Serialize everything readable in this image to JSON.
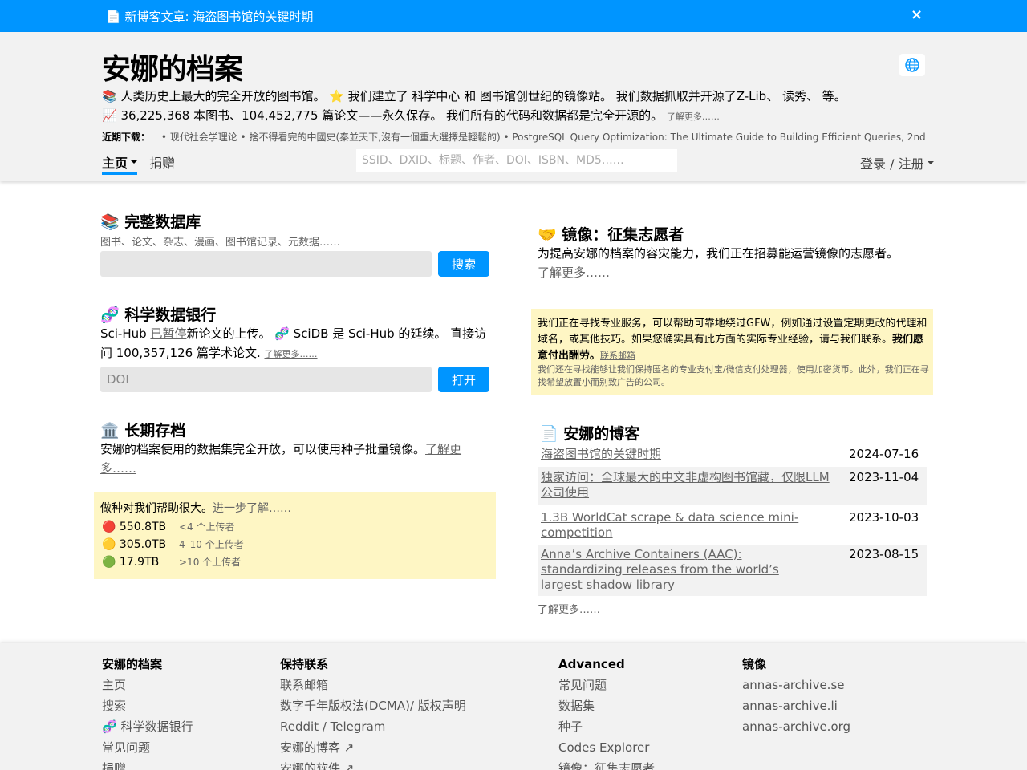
{
  "announcement": {
    "icon": "📄",
    "prefix": "新博客文章:",
    "link": "海盗图书馆的关键时期",
    "close": "×"
  },
  "header": {
    "title": "安娜的档案",
    "tagline1": "📚 人类历史上最大的完全开放的图书馆。 ⭐️ 我们建立了 科学中心 和 图书馆创世纪的镜像站。 我们数据抓取并开源了Z-Lib、 读秀、 等。",
    "tagline2": "📈 36,225,368 本图书、104,452,775 篇论文——永久保存。 我们所有的代码和数据都是完全开源的。",
    "learn_more": "了解更多……",
    "recent_label": "近期下载：",
    "recent_items": "• 现代社会学理论 • 捨不得看完的中國史(秦並天下,沒有一個重大選擇是輕鬆的) • PostgreSQL Query Optimization: The Ultimate Guide to Building Efficient Queries, 2nd",
    "nav_home": "主页",
    "nav_donate": "捐赠",
    "search_placeholder": "SSID、DXID、标题、作者、DOI、ISBN、MD5……",
    "login": "登录 / 注册"
  },
  "full_db": {
    "title": "📚 完整数据库",
    "subtitle": "图书、论文、杂志、漫画、图书馆记录、元数据……",
    "button": "搜索"
  },
  "scidb": {
    "title": "🧬 科学数据银行",
    "text_a": "Sci-Hub",
    "text_paused": "已暂停",
    "text_b": "新论文的上传。 🧬 SciDB 是 Sci-Hub 的延续。 直接访问 100,357,126 篇学术论文.",
    "learn_more": "了解更多……",
    "placeholder": "DOI",
    "button": "打开"
  },
  "archive": {
    "title": "🏛️ 长期存档",
    "text": "安娜的档案使用的数据集完全开放，可以使用种子批量镜像。",
    "learn_more": "了解更多……"
  },
  "seeding": {
    "text": "做种对我们帮助很大。",
    "link": "进一步了解……",
    "rows": [
      {
        "icon": "🔴",
        "size": "550.8TB",
        "count": "<4 个上传者"
      },
      {
        "icon": "🟡",
        "size": "305.0TB",
        "count": "4–10 个上传者"
      },
      {
        "icon": "🟢",
        "size": "17.9TB",
        "count": ">10 个上传者"
      }
    ]
  },
  "mirrors": {
    "title": "🤝 镜像：征集志愿者",
    "text": "为提高安娜的档案的容灾能力，我们正在招募能运营镜像的志愿者。",
    "learn_more": "了解更多……"
  },
  "gfw": {
    "text": "我们正在寻找专业服务，可以帮助可靠地绕过GFW，例如通过设置定期更改的代理和域名，或其他技巧。如果您确实具有此方面的实际专业经验，请与我们联系。",
    "bold": "我们愿意付出酬劳。",
    "link": "联系邮箱",
    "small": "我们还在寻找能够让我们保持匿名的专业支付宝/微信支付处理器，使用加密货币。此外，我们正在寻找希望放置小而别致广告的公司。"
  },
  "blog": {
    "title": "📄 安娜的博客",
    "rows": [
      {
        "title": "海盗图书馆的关键时期",
        "date": "2024-07-16"
      },
      {
        "title": "独家访问：全球最大的中文非虚构图书馆藏，仅限LLM公司使用",
        "date": "2023-11-04"
      },
      {
        "title": "1.3B WorldCat scrape & data science mini-competition",
        "date": "2023-10-03"
      },
      {
        "title": "Anna’s Archive Containers (AAC): standardizing releases from the world’s largest shadow library",
        "date": "2023-08-15"
      }
    ],
    "learn_more": "了解更多……"
  },
  "footer": {
    "col1": {
      "heading": "安娜的档案",
      "links": [
        "主页",
        "搜索",
        "🧬 科学数据银行",
        "常见问题",
        "捐赠"
      ]
    },
    "col2": {
      "heading": "保持联系",
      "links": [
        "联系邮箱",
        "数字千年版权法(DCMA)/ 版权声明",
        "Reddit / Telegram",
        "安娜的博客 ↗",
        "安娜的软件 ↗"
      ]
    },
    "col3": {
      "heading": "Advanced",
      "links": [
        "常见问题",
        "数据集",
        "种子",
        "Codes Explorer",
        "镜像：征集志愿者"
      ]
    },
    "col4": {
      "heading": "镜像",
      "links": [
        "annas-archive.se",
        "annas-archive.li",
        "annas-archive.org"
      ]
    }
  }
}
